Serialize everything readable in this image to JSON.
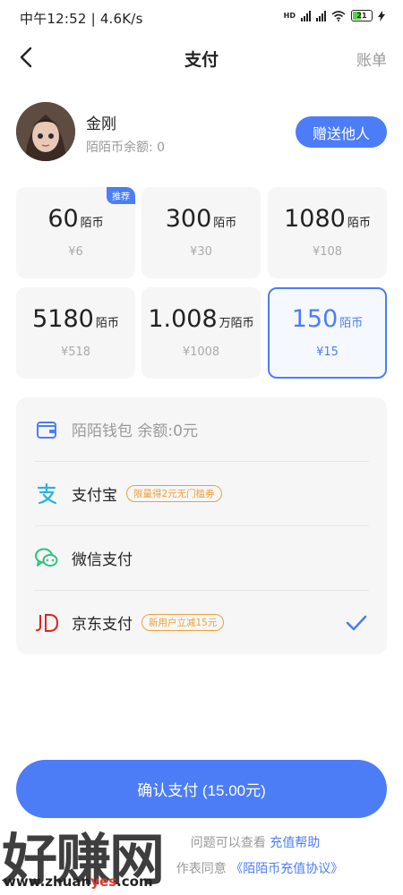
{
  "status_bar": {
    "time": "中午12:52 | 4.6K/s",
    "hd": "HD",
    "battery": "21"
  },
  "nav": {
    "title": "支付",
    "right_label": "账单"
  },
  "profile": {
    "name": "金刚",
    "balance": "陌陌币余额: 0",
    "gift_button": "赠送他人"
  },
  "coin_options": [
    {
      "amount": "60",
      "unit": "陌币",
      "price": "¥6",
      "badge": "推荐"
    },
    {
      "amount": "300",
      "unit": "陌币",
      "price": "¥30"
    },
    {
      "amount": "1080",
      "unit": "陌币",
      "price": "¥108"
    },
    {
      "amount": "5180",
      "unit": "陌币",
      "price": "¥518"
    },
    {
      "amount": "1.008",
      "unit": "万陌币",
      "price": "¥1008"
    },
    {
      "amount": "150",
      "unit": "陌币",
      "price": "¥15",
      "selected": true
    }
  ],
  "payment_methods": [
    {
      "label": "陌陌钱包 余额:0元",
      "icon": "wallet-icon",
      "disabled": true
    },
    {
      "label": "支付宝",
      "icon": "alipay-icon",
      "tag": "限量得2元无门槛券"
    },
    {
      "label": "微信支付",
      "icon": "wechat-icon"
    },
    {
      "label": "京东支付",
      "icon": "jd-icon",
      "tag": "新用户立减15元",
      "selected": true
    }
  ],
  "confirm_button": "确认支付 (15.00元)",
  "footer": {
    "line1_text": "问题可以查看",
    "line1_link": "充值帮助",
    "line2_text": "作表同意",
    "line2_link": "《陌陌币充值协议》"
  },
  "watermark": {
    "text": "好赚网",
    "url_a": "www.zhuan",
    "url_b": "yes",
    "url_c": ".com"
  },
  "colors": {
    "accent": "#4c7df7",
    "tag": "#e9a23b",
    "card_bg": "#f6f6f7"
  }
}
